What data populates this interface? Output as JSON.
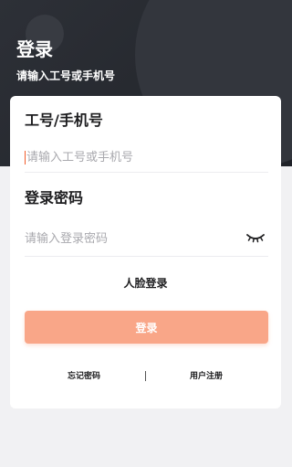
{
  "header": {
    "title": "登录",
    "subtitle": "请输入工号或手机号"
  },
  "form": {
    "account_label": "工号/手机号",
    "account_placeholder": "请输入工号或手机号",
    "account_value": "",
    "password_label": "登录密码",
    "password_placeholder": "请输入登录密码",
    "password_value": "",
    "password_toggle_icon": "eye-closed-icon",
    "face_login_label": "人脸登录",
    "submit_label": "登录"
  },
  "footer_links": {
    "forgot_password": "忘记密码",
    "register": "用户注册"
  },
  "colors": {
    "header_bg": "#26292f",
    "accent_button": "#f9a688",
    "cursor": "#f25c2b"
  }
}
